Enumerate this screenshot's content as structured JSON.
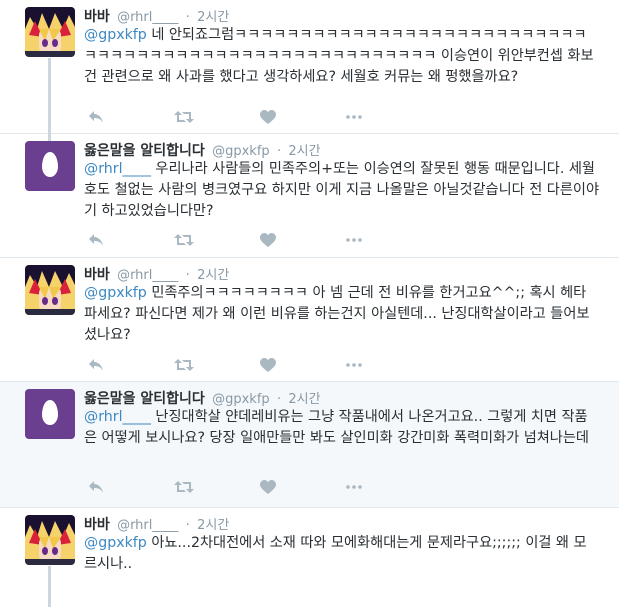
{
  "tweets": [
    {
      "name": "바바",
      "handle": "@rhrl____",
      "time": "2시간",
      "mention": "@gpxkfp",
      "text": " 네 안되죠그럼ㅋㅋㅋㅋㅋㅋㅋㅋㅋㅋㅋㅋㅋㅋㅋㅋㅋㅋㅋㅋㅋㅋㅋㅋㅋㅋㅋㅋㅋㅋㅋㅋㅋㅋㅋㅋㅋㅋㅋㅋㅋㅋㅋㅋㅋㅋㅋㅋㅋㅋㅋㅋㅋㅋ 이승연이 위안부컨셉 화보 건 관련으로 왜 사과를 했다고 생각하세요? 세월호 커뮤는 왜 펑했을까요?",
      "avatar": "yugi"
    },
    {
      "name": "옳은말을 알티합니다",
      "handle": "@gpxkfp",
      "time": "2시간",
      "mention": "@rhrl____",
      "text": " 우리나라 사람들의 민족주의+또는 이승연의 잘못된 행동 때문입니다. 세월호도 철없는 사람의 병크였구요 하지만 이게 지금 나올말은 아닐것같습니다 전 다른이야기 하고있었습니다만?",
      "avatar": "egg"
    },
    {
      "name": "바바",
      "handle": "@rhrl____",
      "time": "2시간",
      "mention": "@gpxkfp",
      "text": " 민족주의ㅋㅋㅋㅋㅋㅋㅋㅋ 아 넴 근데 전 비유를 한거고요^^;; 혹시 헤타파세요? 파신다면 제가 왜 이런 비유를 하는건지 아실텐데... 난징대학살이라고 들어보셨나요?",
      "avatar": "yugi"
    },
    {
      "name": "옳은말을 알티합니다",
      "handle": "@gpxkfp",
      "time": "2시간",
      "mention": "@rhrl____",
      "text": " 난징대학살 얀데레비유는 그냥 작품내에서 나온거고요.. 그렇게 치면 작품은 어떻게 보시나요? 당장 일애만들만 봐도 살인미화 강간미화 폭력미화가 넘쳐나는데",
      "avatar": "egg"
    },
    {
      "name": "바바",
      "handle": "@rhrl____",
      "time": "2시간",
      "mention": "@gpxkfp",
      "text": " 아뇨...2차대전에서 소재 따와 모에화해대는게 문제라구요;;;;;; 이걸 왜 모르시나..",
      "avatar": "yugi"
    }
  ],
  "separator": "·",
  "actions": [
    "reply-icon",
    "retweet-icon",
    "like-icon",
    "more-icon"
  ],
  "colors": {
    "link": "#3b88c3",
    "icon": "#aab8c2",
    "egg_bg": "#6b3f8f",
    "thread_line": "#ccd6dd"
  }
}
